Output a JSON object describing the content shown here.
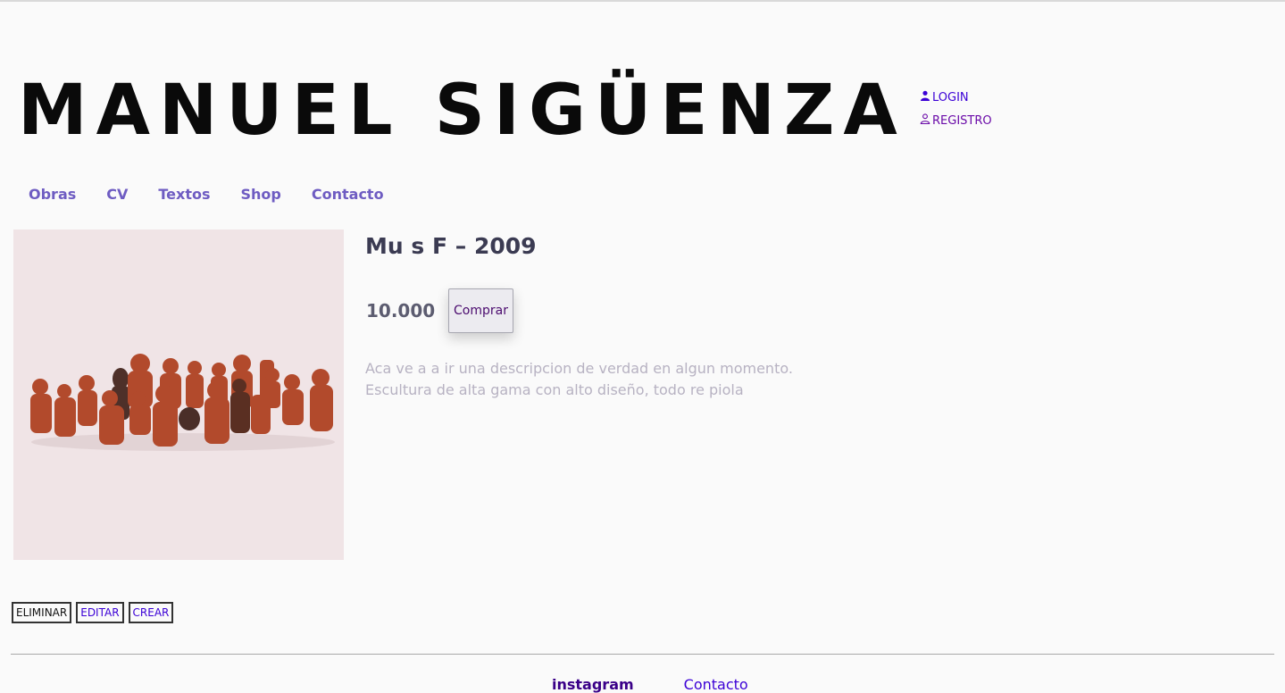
{
  "header": {
    "site_title": "MANUEL SIGÜENZA",
    "account": {
      "login_label": "LOGIN",
      "register_label": "REGISTRO"
    }
  },
  "nav": {
    "items": [
      "Obras",
      "CV",
      "Textos",
      "Shop",
      "Contacto"
    ]
  },
  "product": {
    "title": "Mu s F – 2009",
    "price": "10.000",
    "buy_label": "Comprar",
    "description_line1": "Aca ve a a ir una descripcion de verdad en algun momento.",
    "description_line2": "Escultura de alta gama con alto diseño, todo re piola"
  },
  "admin": {
    "delete_label": "ELIMINAR",
    "edit_label": "EDITAR",
    "create_label": "CREAR"
  },
  "footer": {
    "links": [
      "instagram",
      "Contacto"
    ]
  },
  "colors": {
    "nav": "#6e5cc2",
    "login": "#3b00d6",
    "register": "#6a0aa8",
    "background": "#fafafa"
  }
}
